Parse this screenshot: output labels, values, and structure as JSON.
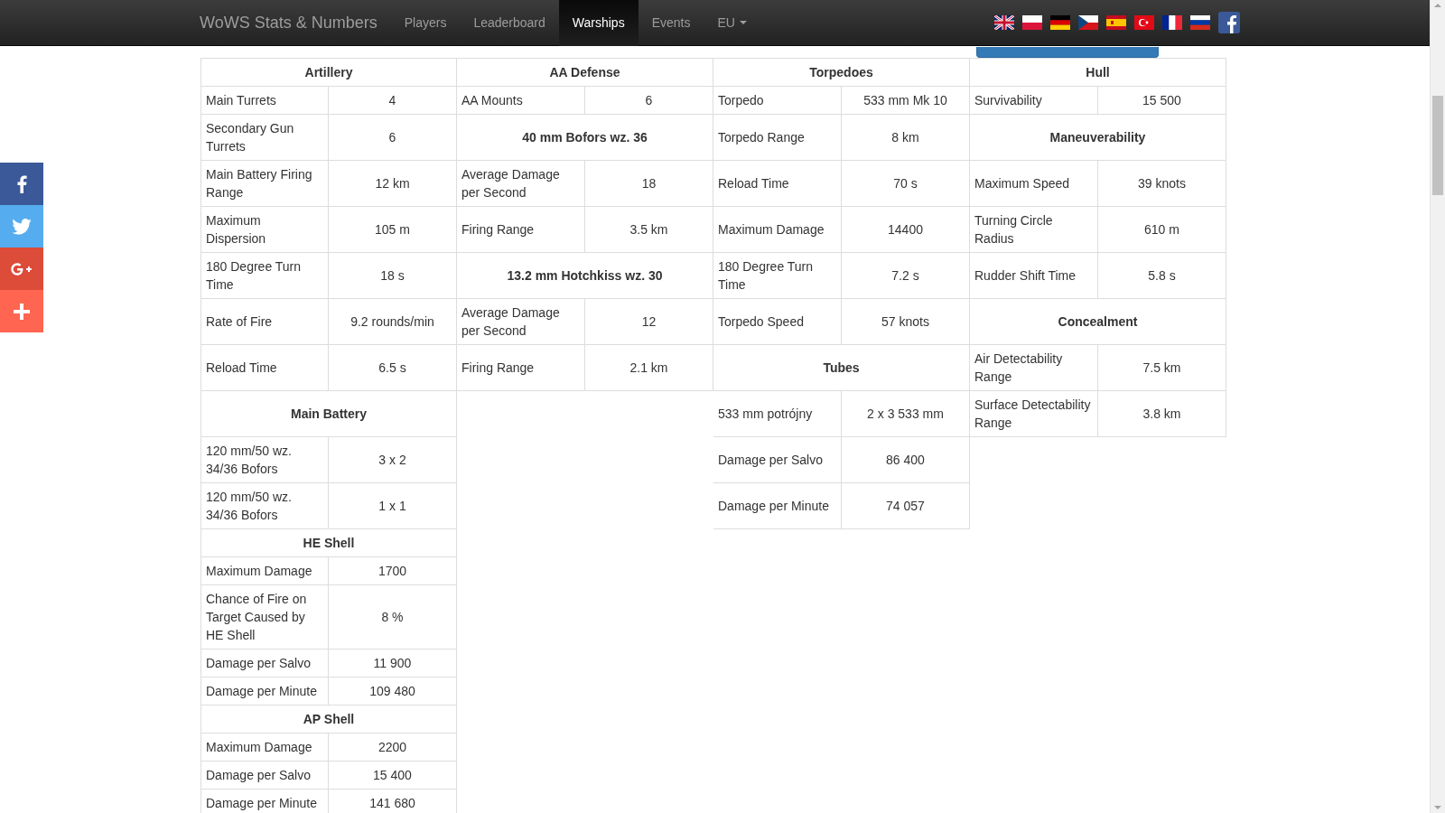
{
  "navbar": {
    "brand": "WoWS Stats & Numbers",
    "items": [
      {
        "label": "Players",
        "selected": false,
        "kind": "link"
      },
      {
        "label": "Leaderboard",
        "selected": false,
        "kind": "link"
      },
      {
        "label": "Warships",
        "selected": true,
        "kind": "link"
      },
      {
        "label": "Events",
        "selected": false,
        "kind": "link"
      },
      {
        "label": "EU",
        "selected": false,
        "kind": "dropdown"
      }
    ],
    "flags": [
      {
        "kind": "uk"
      },
      {
        "kind": "pl"
      },
      {
        "kind": "de"
      },
      {
        "kind": "cz"
      },
      {
        "kind": "es"
      },
      {
        "kind": "tr"
      },
      {
        "kind": "fr"
      },
      {
        "kind": "ru"
      },
      {
        "kind": "facebook"
      }
    ]
  },
  "share_bar": [
    {
      "kind": "facebook",
      "color": "#3b5998"
    },
    {
      "kind": "twitter",
      "color": "#55acee"
    },
    {
      "kind": "googleplus",
      "color": "#dd4b39"
    },
    {
      "kind": "more",
      "color": "#ff6550"
    }
  ],
  "columns": [
    {
      "title": "Artillery",
      "rows": [
        {
          "kind": "row",
          "label": "Main Turrets",
          "value": "4"
        },
        {
          "kind": "row",
          "label": "Secondary Gun Turrets",
          "value": "6"
        },
        {
          "kind": "row",
          "label": "Main Battery Firing Range",
          "value": "12 km"
        },
        {
          "kind": "row",
          "label": "Maximum Dispersion",
          "value": "105 m"
        },
        {
          "kind": "row",
          "label": "180 Degree Turn Time",
          "value": "18 s"
        },
        {
          "kind": "row",
          "label": "Rate of Fire",
          "value": "9.2 rounds/min"
        },
        {
          "kind": "row",
          "label": "Reload Time",
          "value": "6.5 s"
        },
        {
          "kind": "header",
          "label": "Main Battery"
        },
        {
          "kind": "row",
          "label": "120 mm/50 wz. 34/36 Bofors",
          "value": "3 x 2"
        },
        {
          "kind": "row",
          "label": "120 mm/50 wz. 34/36 Bofors",
          "value": "1 x 1"
        },
        {
          "kind": "header",
          "label": "HE Shell"
        },
        {
          "kind": "row",
          "label": "Maximum Damage",
          "value": "1700"
        },
        {
          "kind": "row",
          "label": "Chance of Fire on Target Caused by HE Shell",
          "value": "8 %"
        },
        {
          "kind": "row",
          "label": "Damage per Salvo",
          "value": "11 900"
        },
        {
          "kind": "row",
          "label": "Damage per Minute",
          "value": "109 480"
        },
        {
          "kind": "header",
          "label": "AP Shell"
        },
        {
          "kind": "row",
          "label": "Maximum Damage",
          "value": "2200"
        },
        {
          "kind": "row",
          "label": "Damage per Salvo",
          "value": "15 400"
        },
        {
          "kind": "row",
          "label": "Damage per Minute",
          "value": "141 680"
        }
      ]
    },
    {
      "title": "AA Defense",
      "rows": [
        {
          "kind": "row",
          "label": "AA Mounts",
          "value": "6"
        },
        {
          "kind": "header",
          "label": "40 mm Bofors wz. 36"
        },
        {
          "kind": "row",
          "label": "Average Damage per Second",
          "value": "18"
        },
        {
          "kind": "row",
          "label": "Firing Range",
          "value": "3.5 km"
        },
        {
          "kind": "header",
          "label": "13.2 mm Hotchkiss wz. 30"
        },
        {
          "kind": "row",
          "label": "Average Damage per Second",
          "value": "12"
        },
        {
          "kind": "row",
          "label": "Firing Range",
          "value": "2.1 km"
        }
      ]
    },
    {
      "title": "Torpedoes",
      "rows": [
        {
          "kind": "row",
          "label": "Torpedo",
          "value": "533 mm Mk 10"
        },
        {
          "kind": "row",
          "label": "Torpedo Range",
          "value": "8 km"
        },
        {
          "kind": "row",
          "label": "Reload Time",
          "value": "70 s"
        },
        {
          "kind": "row",
          "label": "Maximum Damage",
          "value": "14400"
        },
        {
          "kind": "row",
          "label": "180 Degree Turn Time",
          "value": "7.2 s"
        },
        {
          "kind": "row",
          "label": "Torpedo Speed",
          "value": "57 knots"
        },
        {
          "kind": "header",
          "label": "Tubes"
        },
        {
          "kind": "row",
          "label": "533 mm potrójny",
          "value": "2 x 3 533 mm"
        },
        {
          "kind": "row",
          "label": "Damage per Salvo",
          "value": "86 400"
        },
        {
          "kind": "row",
          "label": "Damage per Minute",
          "value": "74 057"
        }
      ]
    },
    {
      "title": "Hull",
      "rows": [
        {
          "kind": "row",
          "label": "Survivability",
          "value": "15 500"
        },
        {
          "kind": "header",
          "label": "Maneuverability"
        },
        {
          "kind": "row",
          "label": "Maximum Speed",
          "value": "39 knots"
        },
        {
          "kind": "row",
          "label": "Turning Circle Radius",
          "value": "610 m"
        },
        {
          "kind": "row",
          "label": "Rudder Shift Time",
          "value": "5.8 s"
        },
        {
          "kind": "header",
          "label": "Concealment"
        },
        {
          "kind": "row",
          "label": "Air Detectability Range",
          "value": "7.5 km"
        },
        {
          "kind": "row",
          "label": "Surface Detectability Range",
          "value": "3.8 km"
        }
      ]
    }
  ]
}
